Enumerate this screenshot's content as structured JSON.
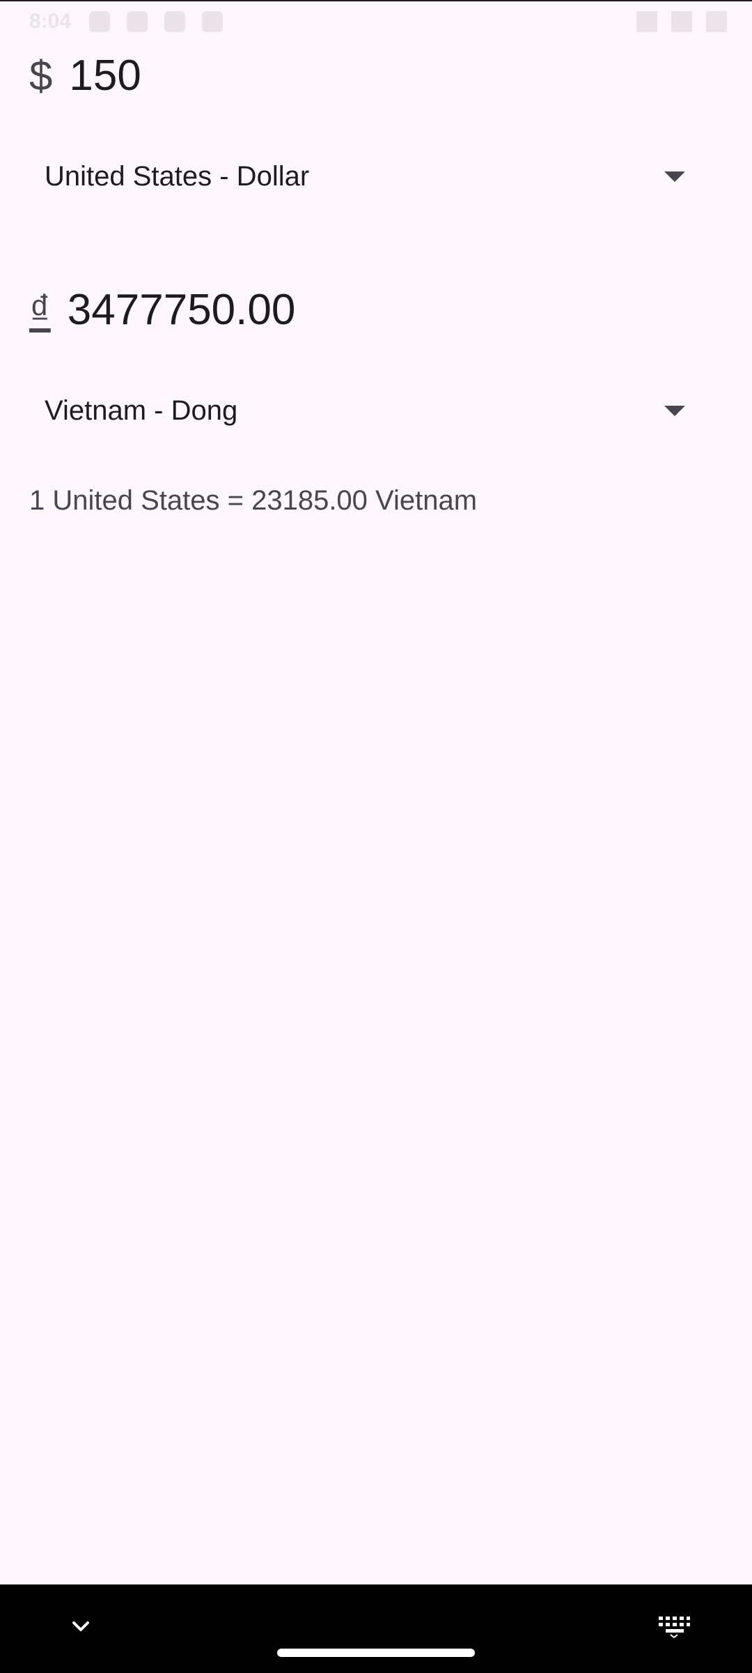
{
  "status_bar": {
    "time": "8:04"
  },
  "from": {
    "symbol": "$",
    "amount": "150",
    "currency_label": "United States - Dollar"
  },
  "to": {
    "symbol": "₫",
    "amount": "3477750.00",
    "currency_label": "Vietnam - Dong"
  },
  "rate_text": "1 United States = 23185.00 Vietnam",
  "icons": {
    "dropdown": "triangle-down-icon",
    "nav_collapse": "chevron-down-icon",
    "nav_keyboard": "keyboard-icon"
  },
  "colors": {
    "background": "#fdf7fc",
    "text_primary": "#1d1b20",
    "text_secondary": "#49454f",
    "nav_bar": "#000000"
  }
}
